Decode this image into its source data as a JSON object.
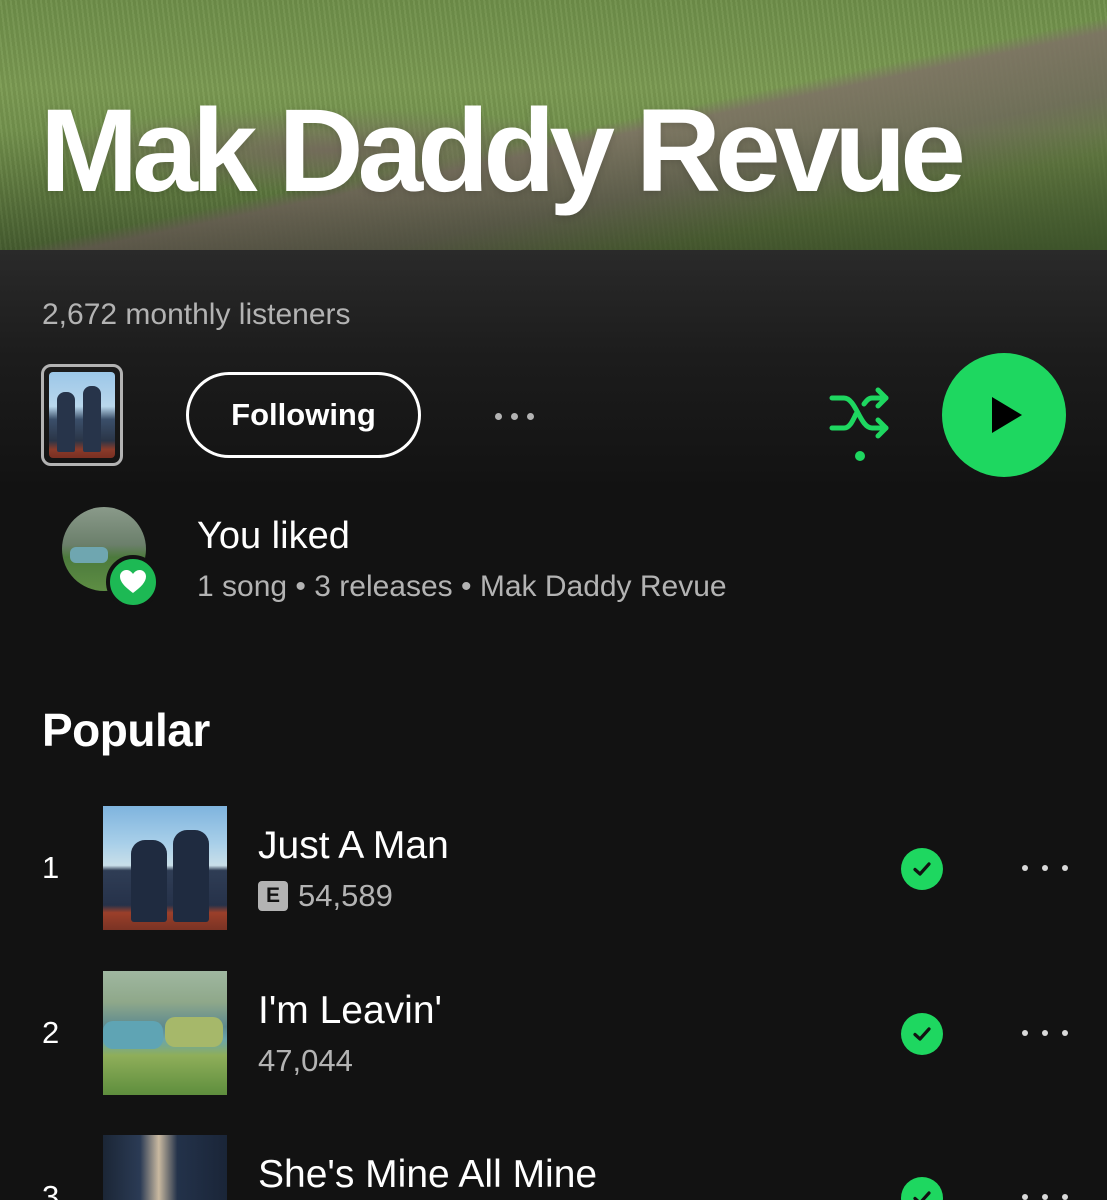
{
  "artist": {
    "name": "Mak Daddy Revue",
    "monthly_listeners": "2,672 monthly listeners"
  },
  "actions": {
    "follow_label": "Following",
    "more_icon": "more-horizontal-icon",
    "shuffle_icon": "shuffle-icon",
    "play_icon": "play-icon"
  },
  "liked": {
    "title": "You liked",
    "subtitle": "1 song • 3 releases • Mak Daddy Revue",
    "badge_icon": "heart-icon"
  },
  "popular": {
    "title": "Popular",
    "tracks": [
      {
        "number": "1",
        "title": "Just A Man",
        "explicit": "E",
        "plays": "54,589"
      },
      {
        "number": "2",
        "title": "I'm Leavin'",
        "plays": "47,044"
      },
      {
        "number": "3",
        "title": "She's Mine All Mine"
      }
    ]
  },
  "colors": {
    "accent": "#1ed760",
    "background": "#121212",
    "secondary_text": "#b3b3b3"
  }
}
